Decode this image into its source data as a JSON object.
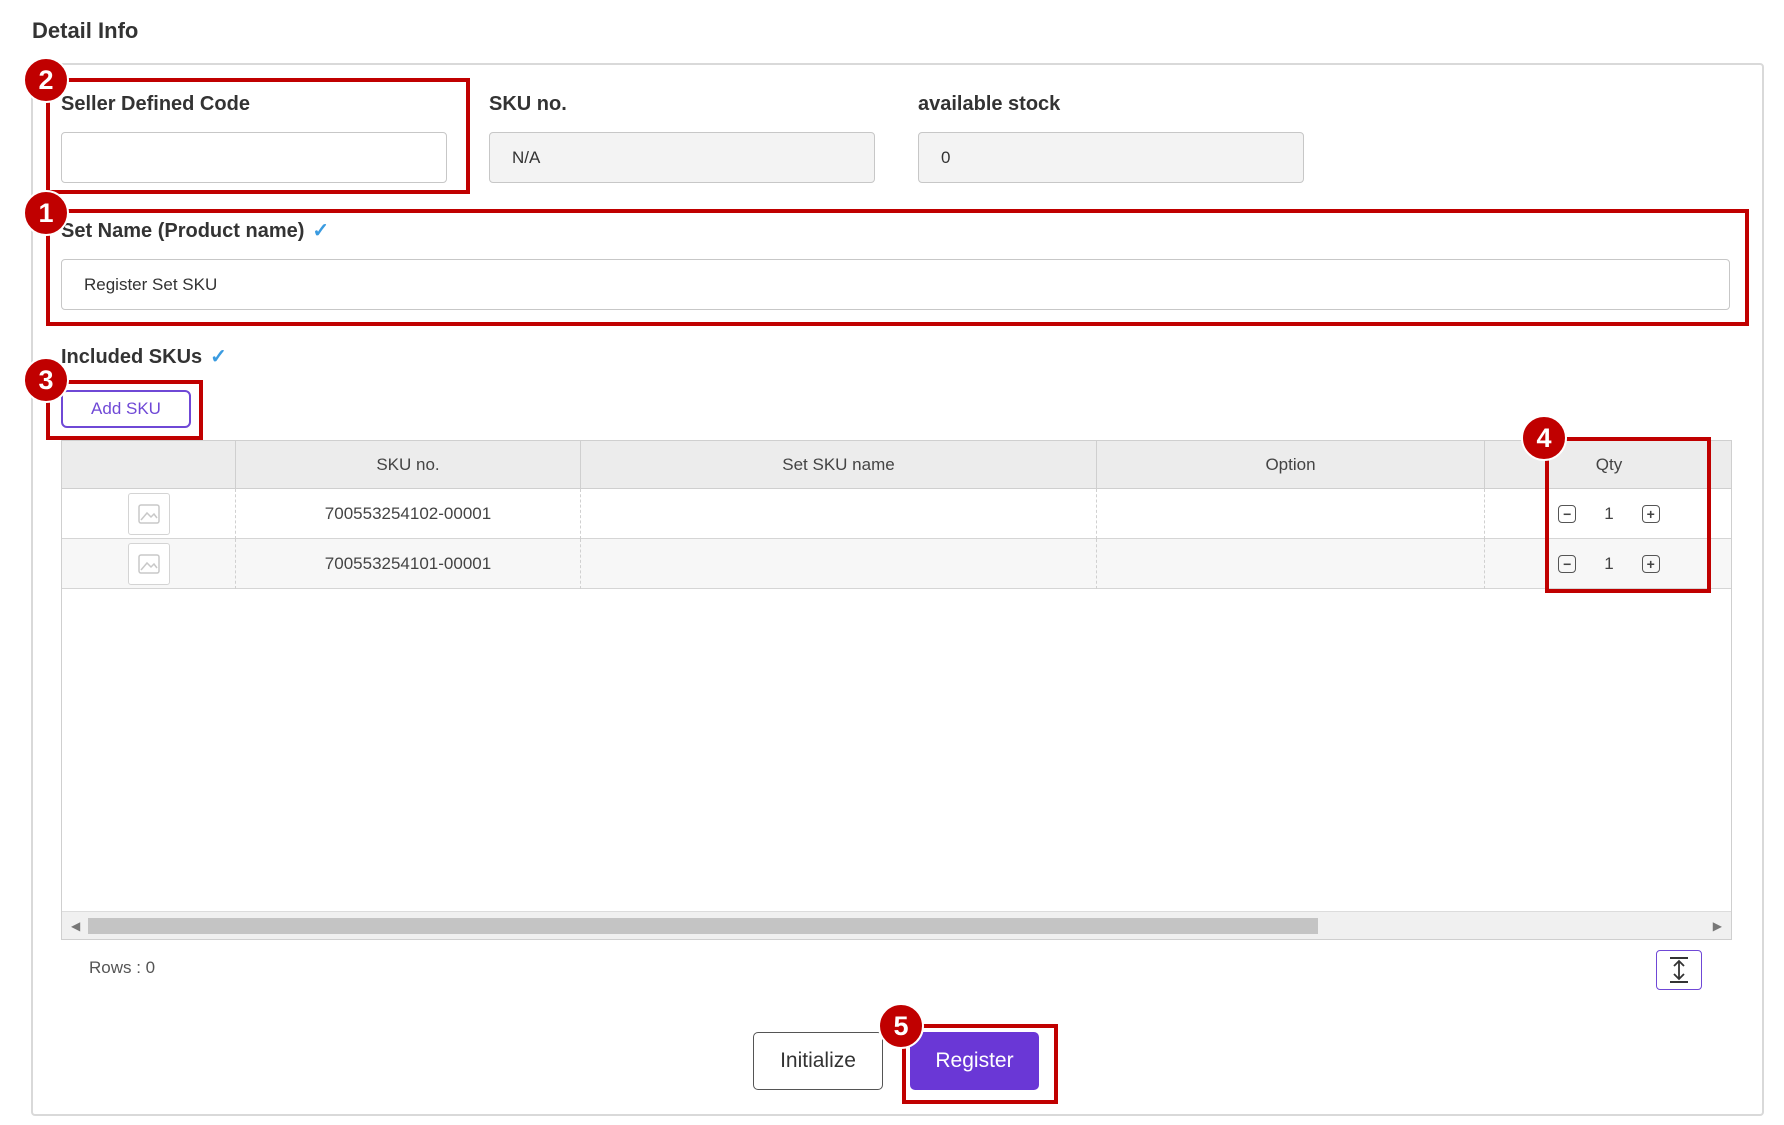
{
  "section": {
    "title": "Detail Info"
  },
  "fields": {
    "seller_code": {
      "label": "Seller Defined Code",
      "value": ""
    },
    "sku_no": {
      "label": "SKU no.",
      "value": "N/A"
    },
    "available_stock": {
      "label": "available stock",
      "value": "0"
    },
    "set_name": {
      "label": "Set Name (Product name)",
      "value": "Register Set SKU"
    }
  },
  "included_skus": {
    "label": "Included SKUs",
    "add_button": "Add SKU",
    "columns": [
      "SKU no.",
      "Set SKU name",
      "Option",
      "Qty"
    ],
    "rows": [
      {
        "sku_no": "700553254102-00001",
        "set_sku_name": "",
        "option": "",
        "qty": "1"
      },
      {
        "sku_no": "700553254101-00001",
        "set_sku_name": "",
        "option": "",
        "qty": "1"
      }
    ],
    "rows_count": "Rows : 0"
  },
  "actions": {
    "initialize": "Initialize",
    "register": "Register"
  },
  "annotations": [
    "1",
    "2",
    "3",
    "4",
    "5"
  ],
  "colors": {
    "accent": "#6a37d6",
    "highlight": "#c00000",
    "check": "#3a9be0"
  }
}
